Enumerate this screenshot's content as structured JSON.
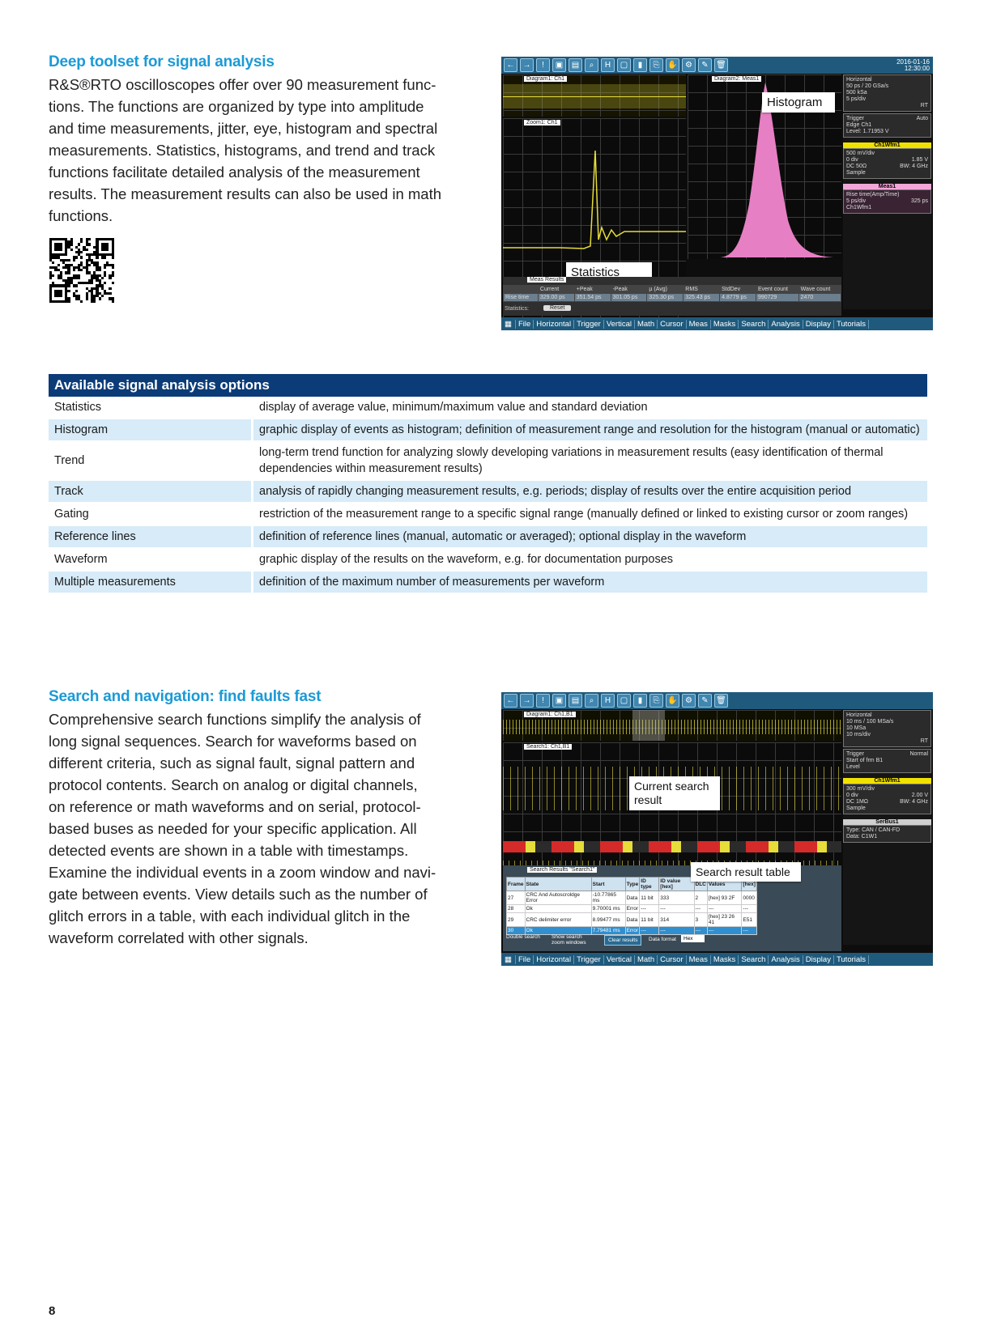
{
  "section1": {
    "heading": "Deep toolset for signal analysis",
    "body": "R&S®RTO oscilloscopes offer over 90 measurement func-\ntions. The functions are organized by type into amplitude\nand time measurements, jitter, eye, histogram and spectral\nmeasurements. Statistics, histograms, and trend and track\nfunctions facilitate detailed analysis of the measurement\nresults. The measurement results can also be used in math\nfunctions.",
    "screen": {
      "date": "2016-01-16",
      "time": "12:30:00",
      "diagram1_tab": "Diagram1: Ch1",
      "zoom_tab": "Zoom1: Ch1",
      "diagram2_tab": "Diagram2: Meas1",
      "callout_histogram": "Histogram",
      "callout_statistics": "Statistics",
      "results_tab": "Meas Results",
      "results_headers": [
        "",
        "Current",
        "+Peak",
        "-Peak",
        "µ (Avg)",
        "RMS",
        "StdDev",
        "Event count",
        "Wave count"
      ],
      "results_row": [
        "Rise time",
        "329.00 ps",
        "351.54 ps",
        "301.05 ps",
        "325.30 ps",
        "325.43 ps",
        "4.8779 ps",
        "990729",
        "2470"
      ],
      "meas_label": "Meas 1",
      "statistics_label": "Statistics:",
      "reset_label": "Reset",
      "side_horizontal": [
        "Horizontal",
        "50 ps / 20 GSa/s",
        "500 kSa",
        "5 ps/div",
        "RT"
      ],
      "side_trigger": [
        "Trigger",
        "Auto",
        "Edge",
        "Ch1",
        "Level: 1.71953 V"
      ],
      "side_ch_title": "Ch1Wfm1",
      "side_ch_lines": [
        "500 mV/div",
        "0 div",
        "1.85 V",
        "DC 50Ω",
        "BW: 4 GHz",
        "Sample"
      ],
      "side_meas_title": "Meas1",
      "side_meas_lines": [
        "Rise time(Amp/Time)",
        "5 ps/div",
        "325 ps",
        "Ch1Wfm1"
      ]
    }
  },
  "table": {
    "title": "Available signal analysis options",
    "rows": [
      {
        "name": "Statistics",
        "desc": "display of average value, minimum/maximum value and standard deviation"
      },
      {
        "name": "Histogram",
        "desc": "graphic display of events as histogram; definition of measurement range and resolution for the histogram (manual or automatic)"
      },
      {
        "name": "Trend",
        "desc": "long-term trend function for analyzing slowly developing variations in measurement results (easy identification of thermal dependencies within measurement results)"
      },
      {
        "name": "Track",
        "desc": "analysis of rapidly changing measurement results, e.g. periods; display of results over the entire acquisition period"
      },
      {
        "name": "Gating",
        "desc": "restriction of the measurement range to a specific signal range (manually defined or linked to existing cursor or zoom ranges)"
      },
      {
        "name": "Reference lines",
        "desc": "definition of reference lines (manual, automatic or averaged); optional display in the waveform"
      },
      {
        "name": "Waveform",
        "desc": "graphic display of the results on the waveform, e.g. for documentation purposes"
      },
      {
        "name": "Multiple measurements",
        "desc": "definition of the maximum number of measurements per waveform"
      }
    ]
  },
  "section2": {
    "heading": "Search and navigation: find faults fast",
    "body": "Comprehensive search functions simplify the analysis of\nlong signal sequences. Search for waveforms based on\ndifferent criteria, such as signal fault, signal pattern and\nprotocol contents. Search on analog or digital channels,\non reference or math waveforms and on serial, protocol-\nbased buses as needed for your specific application. All\ndetected events are shown in a table with timestamps.\nExamine the individual events in a zoom window and navi-\ngate between events. View details such as the number of\nglitch errors in a table, with each individual glitch in the\nwaveform correlated with other signals.",
    "screen": {
      "diagram1_tab": "Diagram1: Ch1,B1",
      "search_tab": "Search1: Ch1,B1",
      "callout_current": "Current search\nresult",
      "callout_table": "Search result table",
      "results_tab": "Search Results \"Search1\"",
      "table_headers": [
        "Frame",
        "State",
        "Start",
        "Type",
        "ID type",
        "ID value [hex]",
        "DLC",
        "Values",
        "[hex]"
      ],
      "table_rows": [
        [
          "27",
          "CRC And Autoscroldge Error",
          "-10.77865 ms",
          "Data",
          "11 bit",
          "333",
          "2",
          "[hex] 93 2F",
          "0000"
        ],
        [
          "28",
          "Ok",
          "9.70001 ms",
          "Error",
          "---",
          "---",
          "---",
          "---",
          "---"
        ],
        [
          "29",
          "CRC delimiter error",
          "8.99477 ms",
          "Data",
          "11 bit",
          "314",
          "3",
          "[hex] 23 26 41",
          "E51"
        ],
        [
          "30",
          "Ok",
          "7.79481 ms",
          "Error",
          "---",
          "---",
          "---",
          "---",
          "---"
        ]
      ],
      "double_search": "Double search",
      "show_zoom": "Show search zoom windows",
      "clear_results": "Clear results",
      "data_format_label": "Data format",
      "data_format_value": "Hex",
      "side_horizontal": [
        "Horizontal",
        "10 ms / 100 MSa/s",
        "10 MSa",
        "10 ms/div",
        "RT"
      ],
      "side_trigger": [
        "Trigger",
        "Normal",
        "Start of frm",
        "B1",
        "Level"
      ],
      "side_ch_title": "Ch1Wfm1",
      "side_ch_lines": [
        "300 mV/div",
        "0 div",
        "2.00 V",
        "DC 1MΩ",
        "BW: 4 GHz",
        "Sample"
      ],
      "side_bus_title": "SerBus1",
      "side_bus_lines": [
        "Type: CAN / CAN-FD",
        "Data: C1W1"
      ]
    }
  },
  "menu": [
    "File",
    "Horizontal",
    "Trigger",
    "Vertical",
    "Math",
    "Cursor",
    "Meas",
    "Masks",
    "Search",
    "Analysis",
    "Display",
    "Tutorials"
  ],
  "page_number": "8",
  "colors": {
    "heading": "#1b9ad6",
    "table_header": "#0b3c78",
    "table_alt": "#d7ebf8",
    "histogram": "#e77fc4",
    "waveform": "#e6dc3a"
  }
}
